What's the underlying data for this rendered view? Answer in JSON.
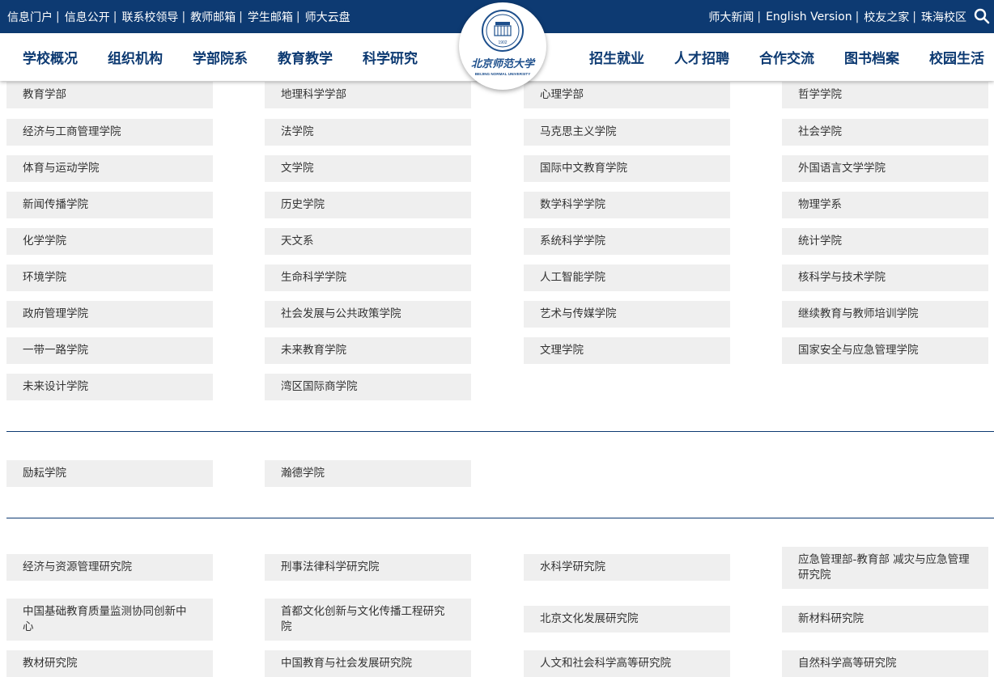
{
  "topbar": {
    "left_links": [
      "信息门户",
      "信息公开",
      "联系校领导",
      "教师邮箱",
      "学生邮箱",
      "师大云盘"
    ],
    "right_links": [
      "师大新闻",
      "English Version",
      "校友之家",
      "珠海校区"
    ],
    "search_icon": "search-icon",
    "background_color": "#0d3a72"
  },
  "nav": {
    "left_items": [
      "学校概况",
      "组织机构",
      "学部院系",
      "教育教学",
      "科学研究"
    ],
    "right_items": [
      "招生就业",
      "人才招聘",
      "合作交流",
      "图书档案",
      "校园生活"
    ],
    "text_color": "#0d3a72"
  },
  "logo": {
    "chinese_name": "北京师范大学",
    "english_name": "BEIJING NORMAL UNIVERSITY",
    "year": "1902"
  },
  "sections": [
    {
      "items": [
        [
          "教育学部",
          "地理科学学部",
          "心理学部",
          "哲学学院"
        ],
        [
          "经济与工商管理学院",
          "法学院",
          "马克思主义学院",
          "社会学院"
        ],
        [
          "体育与运动学院",
          "文学院",
          "国际中文教育学院",
          "外国语言文学学院"
        ],
        [
          "新闻传播学院",
          "历史学院",
          "数学科学学院",
          "物理学系"
        ],
        [
          "化学学院",
          "天文系",
          "系统科学学院",
          "统计学院"
        ],
        [
          "环境学院",
          "生命科学学院",
          "人工智能学院",
          "核科学与技术学院"
        ],
        [
          "政府管理学院",
          "社会发展与公共政策学院",
          "艺术与传媒学院",
          "继续教育与教师培训学院"
        ],
        [
          "一带一路学院",
          "未来教育学院",
          "文理学院",
          "国家安全与应急管理学院"
        ],
        [
          "未来设计学院",
          "湾区国际商学院"
        ]
      ]
    },
    {
      "items": [
        [
          "励耘学院",
          "瀚德学院"
        ]
      ]
    },
    {
      "items": [
        [
          "经济与资源管理研究院",
          "刑事法律科学研究院",
          "水科学研究院",
          "应急管理部-教育部 减灾与应急管理研究院"
        ],
        [
          "中国基础教育质量监测协同创新中心",
          "首都文化创新与文化传播工程研究院",
          "北京文化发展研究院",
          "新材料研究院"
        ],
        [
          "教材研究院",
          "中国教育与社会发展研究院",
          "人文和社会科学高等研究院",
          "自然科学高等研究院"
        ]
      ]
    }
  ]
}
